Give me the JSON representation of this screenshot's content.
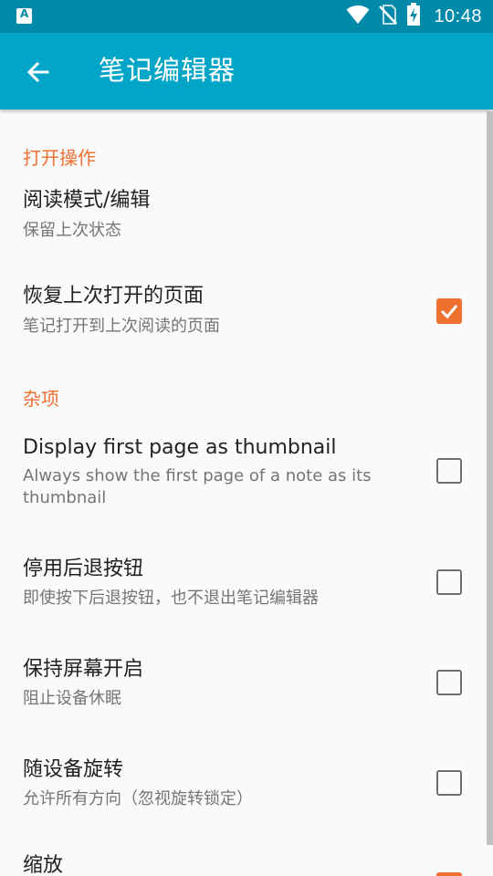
{
  "status_bar": {
    "time": "10:48",
    "icons": [
      "app-notification-icon",
      "wifi-icon",
      "no-sim-icon",
      "battery-charging-icon"
    ]
  },
  "app_bar": {
    "title": "笔记编辑器",
    "back_icon": "arrow-back-icon"
  },
  "colors": {
    "status_bar": "#0089a8",
    "app_bar": "#00a5c8",
    "accent": "#f07030",
    "background": "#fafafa"
  },
  "sections": [
    {
      "header": "打开操作",
      "prefs": [
        {
          "title": "阅读模式/编辑",
          "summary": "保留上次状态"
        },
        {
          "title": "恢复上次打开的页面",
          "summary": "笔记打开到上次阅读的页面",
          "checked": true
        }
      ]
    },
    {
      "header": "杂项",
      "prefs": [
        {
          "title": "Display first page as thumbnail",
          "summary": "Always show the first page of a note as its thumbnail",
          "checked": false
        },
        {
          "title": "停用后退按钮",
          "summary": "即使按下后退按钮，也不退出笔记编辑器",
          "checked": false
        },
        {
          "title": "保持屏幕开启",
          "summary": "阻止设备休眠",
          "checked": false
        },
        {
          "title": "随设备旋转",
          "summary": "允许所有方向（忽视旋转锁定）",
          "checked": false
        },
        {
          "title": "缩放",
          "checked": true
        }
      ]
    }
  ]
}
